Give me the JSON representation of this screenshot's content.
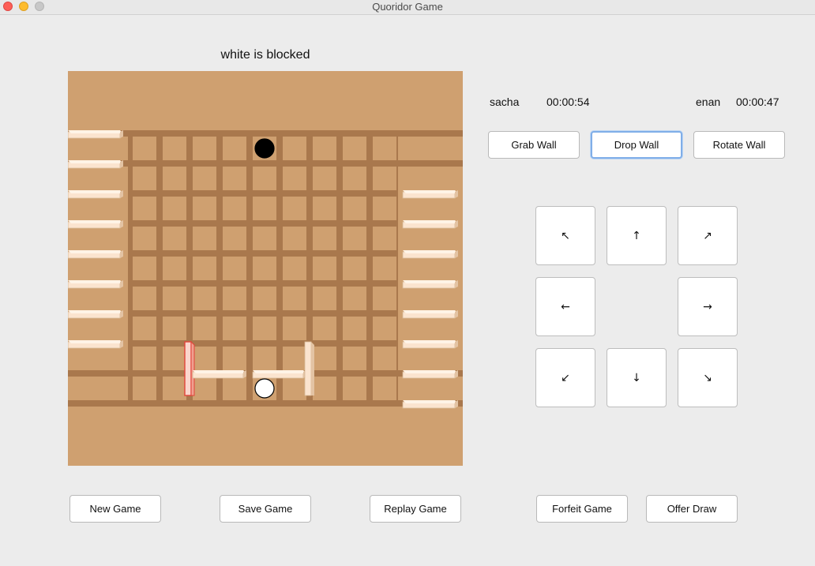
{
  "window": {
    "title": "Quoridor Game"
  },
  "status": "white is blocked",
  "players": [
    {
      "name": "sacha",
      "time": "00:00:54"
    },
    {
      "name": "enan",
      "time": "00:00:47"
    }
  ],
  "wall_actions": {
    "grab": "Grab Wall",
    "drop": "Drop Wall",
    "rotate": "Rotate Wall"
  },
  "moves": {
    "up_left": "↖",
    "up": "↑",
    "up_right": "↗",
    "left": "←",
    "right": "→",
    "down_left": "↙",
    "down": "↓",
    "down_right": "↘"
  },
  "game_actions": {
    "new_game": "New Game",
    "save_game": "Save Game",
    "replay_game": "Replay Game",
    "forfeit_game": "Forfeit Game",
    "offer_draw": "Offer Draw"
  },
  "board": {
    "size": 9,
    "black_pawn": {
      "row": 1,
      "col": 5
    },
    "white_pawn": {
      "row": 9,
      "col": 5
    },
    "stock_walls_black": 8,
    "stock_walls_white": 8,
    "placed_walls": [
      {
        "orientation": "vertical",
        "row": 8,
        "col": 2,
        "selected": true
      },
      {
        "orientation": "horizontal",
        "row": 8,
        "col": 3,
        "selected": false
      },
      {
        "orientation": "horizontal",
        "row": 8,
        "col": 5,
        "selected": false
      },
      {
        "orientation": "vertical",
        "row": 8,
        "col": 6,
        "selected": false
      }
    ]
  }
}
